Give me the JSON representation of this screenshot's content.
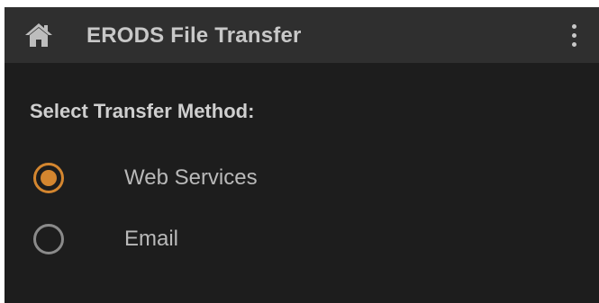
{
  "header": {
    "title": "ERODS File Transfer",
    "home_icon": "home-icon",
    "menu_icon": "kebab-menu-icon"
  },
  "transfer": {
    "label": "Select Transfer Method:",
    "options": [
      {
        "label": "Web Services",
        "selected": true
      },
      {
        "label": "Email",
        "selected": false
      }
    ]
  },
  "colors": {
    "accent": "#d4862f",
    "background": "#1d1d1d",
    "header_background": "#2f2f2f",
    "text": "#b9b9b9"
  }
}
